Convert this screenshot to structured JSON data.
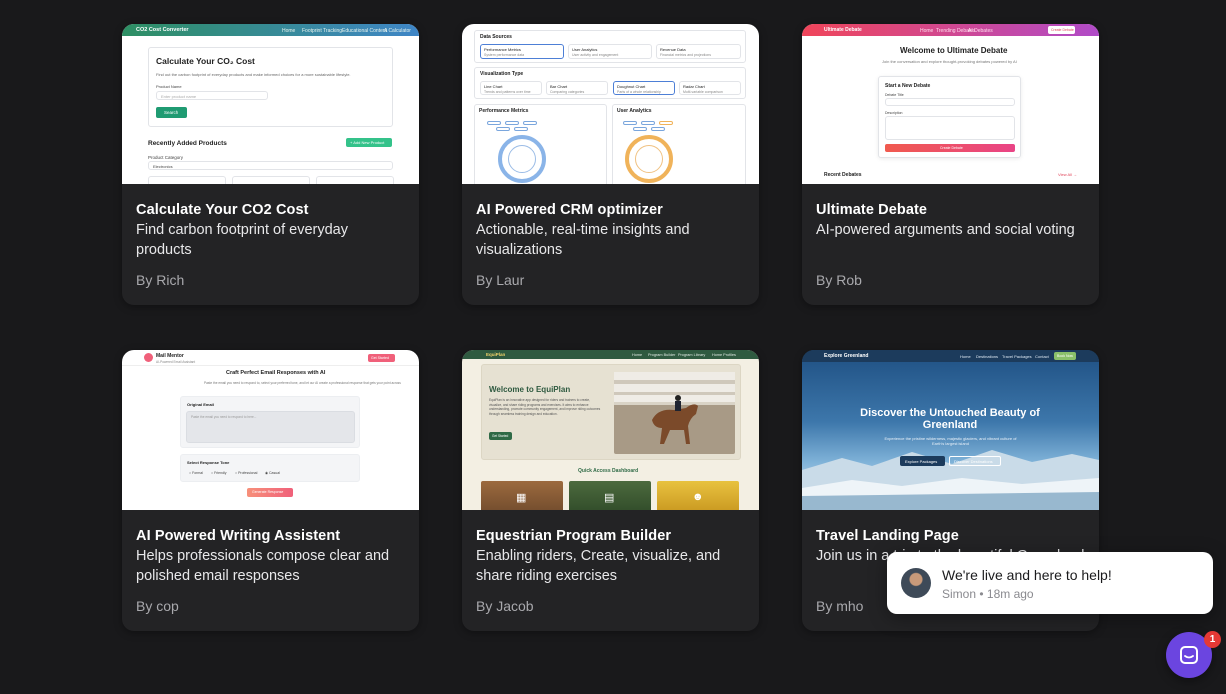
{
  "cards": [
    {
      "title": "Calculate Your CO2 Cost",
      "description": "Find carbon footprint of everyday products",
      "author": "By Rich",
      "thumb": {
        "nav_brand": "CO2 Cost Converter",
        "nav_links": [
          "Home",
          "Footprint Tracking",
          "Educational Content",
          "A Calculator"
        ],
        "heading": "Calculate Your CO₂ Cost",
        "subtext": "Find out the carbon footprint of everyday products and make informed choices for a more sustainable lifestyle.",
        "field_label": "Product Name",
        "field_placeholder": "Enter product name",
        "search_button": "Search",
        "section_title": "Recently Added Products",
        "add_button": "+ Add New Product",
        "filter_label": "Product Category",
        "filter_value": "Electronics",
        "colors": {
          "nav_start": "#2e8f63",
          "nav_end": "#3f86c7",
          "accent": "#1f9b72"
        }
      }
    },
    {
      "title": "AI Powered CRM optimizer",
      "description": "Actionable, real-time insights and visualizations",
      "author": "By Laur",
      "thumb": {
        "sources_title": "Data Sources",
        "sources": [
          {
            "name": "Performance Metrics",
            "sub": "System performance data"
          },
          {
            "name": "User Analytics",
            "sub": "User activity and engagement"
          },
          {
            "name": "Revenue Data",
            "sub": "Financial metrics and projections"
          }
        ],
        "viz_title": "Visualization Type",
        "viz_types": [
          {
            "name": "Line Chart",
            "sub": "Trends and patterns over time"
          },
          {
            "name": "Bar Chart",
            "sub": "Comparing categories"
          },
          {
            "name": "Doughnut Chart",
            "sub": "Parts of a whole relationship"
          },
          {
            "name": "Radar Chart",
            "sub": "Multi-variable comparison"
          }
        ],
        "panel_left": "Performance Metrics",
        "panel_right": "User Analytics"
      }
    },
    {
      "title": "Ultimate Debate",
      "description": "AI-powered arguments and social voting",
      "author": "By Rob",
      "thumb": {
        "nav_brand": "Ultimate Debate",
        "nav_links": [
          "Home",
          "Trending Debates",
          "AI Debates"
        ],
        "nav_button": "Create Debate",
        "heading": "Welcome to Ultimate Debate",
        "subtext": "Join the conversation and explore thought-provoking debates powered by AI",
        "form_title": "Start a New Debate",
        "field_title": "Debate Title",
        "field_desc": "Description",
        "submit": "Create Debate",
        "recent": "Recent Debates",
        "view_all": "View All →",
        "colors": {
          "nav_start": "#f0455a",
          "nav_end": "#b04bc8",
          "accent": "#f05a4e"
        }
      }
    },
    {
      "title": "AI Powered Writing Assistent",
      "description": "Helps professionals compose clear and polished email responses",
      "author": "By cop",
      "thumb": {
        "brand": "Mail Mentor",
        "brand_sub": "AI-Powered Email Assistant",
        "nav_button": "Get Started",
        "heading": "Craft Perfect Email Responses with AI",
        "subtext": "Paste the email you need to respond to, select your preferred tone, and let our AI create a professional response that gets your point across",
        "field_label": "Original Email",
        "field_placeholder": "Paste the email you need to respond to here...",
        "tone_label": "Select Response Tone",
        "tones": [
          "Formal",
          "Friendly",
          "Professional",
          "Casual"
        ],
        "generate": "Generate Response",
        "colors": {
          "accent": "#f0607a"
        }
      }
    },
    {
      "title": "Equestrian Program Builder",
      "description": "Enabling riders, Create, visualize, and share riding exercises",
      "author": "By Jacob",
      "thumb": {
        "nav_brand": "EquiPlan",
        "nav_links": [
          "Home",
          "Program Builder",
          "Program Library",
          "Home Profiles"
        ],
        "heading": "Welcome to EquiPlan",
        "subtext": "EquiPlan is an innovative app designed for riders and trainers to create, visualize, and share riding programs and exercises. It aims to enhance understanding, promote community engagement, and improve riding outcomes through seamless training design and education.",
        "cta": "Get Started",
        "dashboard": "Quick Access Dashboard",
        "colors": {
          "nav": "#2f5a40",
          "bg": "#efeadc",
          "accent": "#2f6a46"
        }
      }
    },
    {
      "title": "Travel Landing Page",
      "description": "Join us in a trip to the beautiful Greenland",
      "author": "By mho",
      "thumb": {
        "nav_brand": "Explore Greenland",
        "nav_links": [
          "Home",
          "Destinations",
          "Travel Packages",
          "Contact"
        ],
        "nav_button": "Book Now",
        "heading": "Discover the Untouched Beauty of Greenland",
        "subtext": "Experience the pristine wilderness, majestic glaciers, and vibrant culture of Earth's largest island",
        "btn_primary": "Explore Packages",
        "btn_secondary": "Discover Destinations",
        "colors": {
          "nav": "#1c3b5c",
          "sky_top": "#1e4f82",
          "sky_bottom": "#7fb2d8"
        }
      }
    }
  ],
  "chat": {
    "message": "We're live and here to help!",
    "sender": "Simon",
    "time": "18m ago",
    "unread": "1",
    "colors": {
      "launcher": "#6b45e0",
      "badge": "#e53935"
    }
  }
}
